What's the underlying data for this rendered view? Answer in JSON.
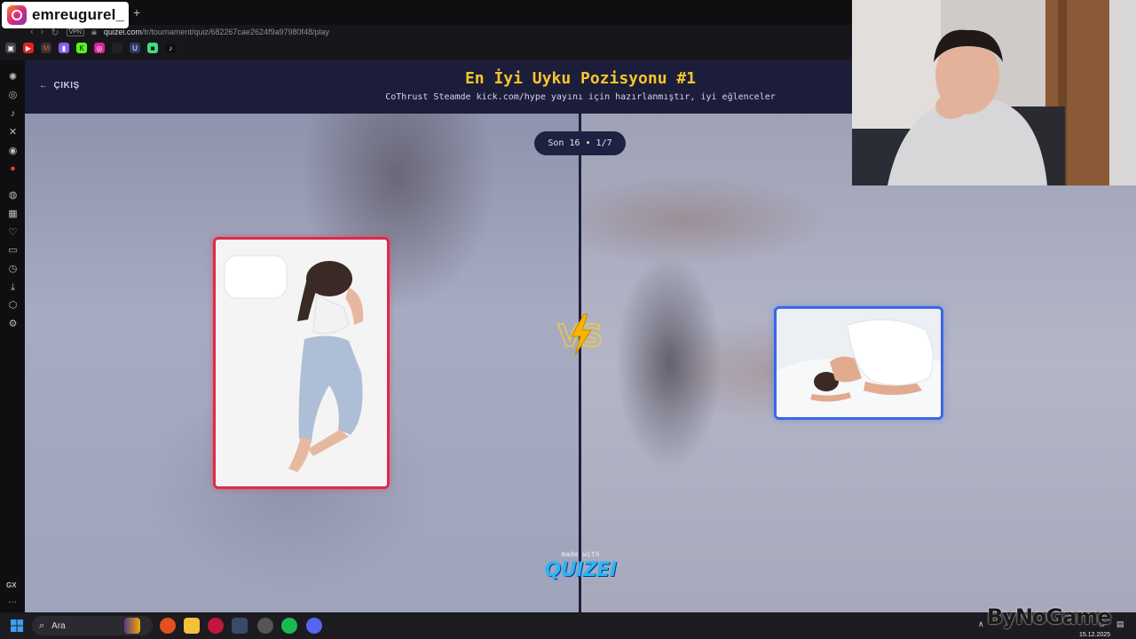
{
  "overlay": {
    "instagram_handle": "emreugurel_"
  },
  "browser": {
    "url_domain": "quizei.com",
    "url_path": "/tr/tournament/quiz/682267cae2624f9a97980f48/play",
    "vpn_label": "VPN",
    "new_tab_label": "+"
  },
  "quiz": {
    "exit_label": "ÇIKIŞ",
    "title": "En İyi Uyku Pozisyonu #1",
    "subtitle": "CoThrust Steamde kick.com/hype yayını için hazırlanmıştır, iyi eğlenceler",
    "round": "Son 16 • 1/7",
    "vs_label": "VS",
    "made_with": "made with",
    "brand": "QUIZEI"
  },
  "taskbar": {
    "search_placeholder": "Ara",
    "date": "15.12.2025"
  },
  "watermark": "ByNoGame",
  "colors": {
    "header_bg": "#1c1d3a",
    "title": "#f5c62b",
    "left_card_border": "#e0294a",
    "right_card_border": "#3a67e8",
    "brand": "#29b6f6"
  }
}
